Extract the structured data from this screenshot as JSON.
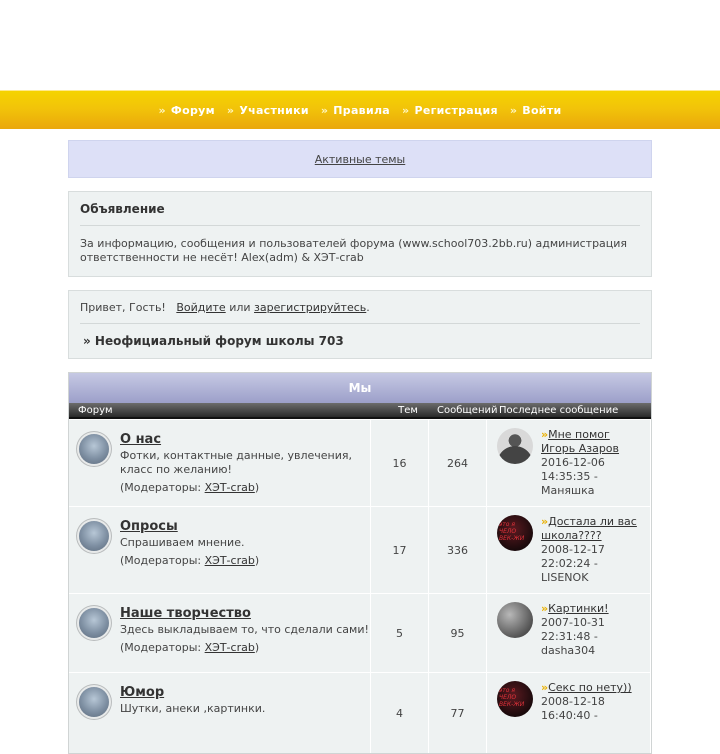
{
  "nav": {
    "items": [
      "Форум",
      "Участники",
      "Правила",
      "Регистрация",
      "Войти"
    ]
  },
  "active_topics": "Активные темы",
  "announcement": {
    "title": "Объявление",
    "text": "За информацию, сообщения и пользователей форума (www.school703.2bb.ru) администрация ответственности не несёт! Alex(adm) & ХЭТ-crab"
  },
  "welcome": {
    "greeting": "Привет, Гость!",
    "login": "Войдите",
    "or": "или",
    "register": "зарегистрируйтесь",
    "forum_name": "» Неофициальный форум школы 703"
  },
  "category": {
    "title": "Мы",
    "columns": [
      "Форум",
      "Тем",
      "Сообщений",
      "Последнее сообщение"
    ],
    "forums": [
      {
        "title": "О нас",
        "desc": "Фотки, контактные данные, увлечения, класс по желанию!",
        "moderators_label": "(Модераторы:",
        "moderator": "ХЭТ-crab",
        "topics": "16",
        "posts": "264",
        "last_title": "Мне помог Игорь Азаров",
        "last_date": "2016-12-06 14:35:35 -",
        "last_user": "Маняшка",
        "avatar": "person"
      },
      {
        "title": "Опросы",
        "desc": "Спрашиваем мнение.",
        "moderators_label": "(Модераторы:",
        "moderator": "ХЭТ-crab",
        "topics": "17",
        "posts": "336",
        "last_title": "Достала ли вас школа????",
        "last_date": "2008-12-17 22:02:24 -",
        "last_user": "LISENOK",
        "avatar": "dark"
      },
      {
        "title": "Наше творчество",
        "desc": "Здесь выкладываем то, что сделали сами!",
        "moderators_label": "(Модераторы:",
        "moderator": "ХЭТ-crab",
        "topics": "5",
        "posts": "95",
        "last_title": "Картинки!",
        "last_date": "2007-10-31 22:31:48 -",
        "last_user": "dasha304",
        "avatar": "grey"
      },
      {
        "title": "Юмор",
        "desc": "Шутки, анеки ,картинки.",
        "moderators_label": "",
        "moderator": "",
        "topics": "4",
        "posts": "77",
        "last_title": "Секс по нету))",
        "last_date": "2008-12-18 16:40:40 -",
        "last_user": "",
        "avatar": "dark"
      }
    ]
  }
}
